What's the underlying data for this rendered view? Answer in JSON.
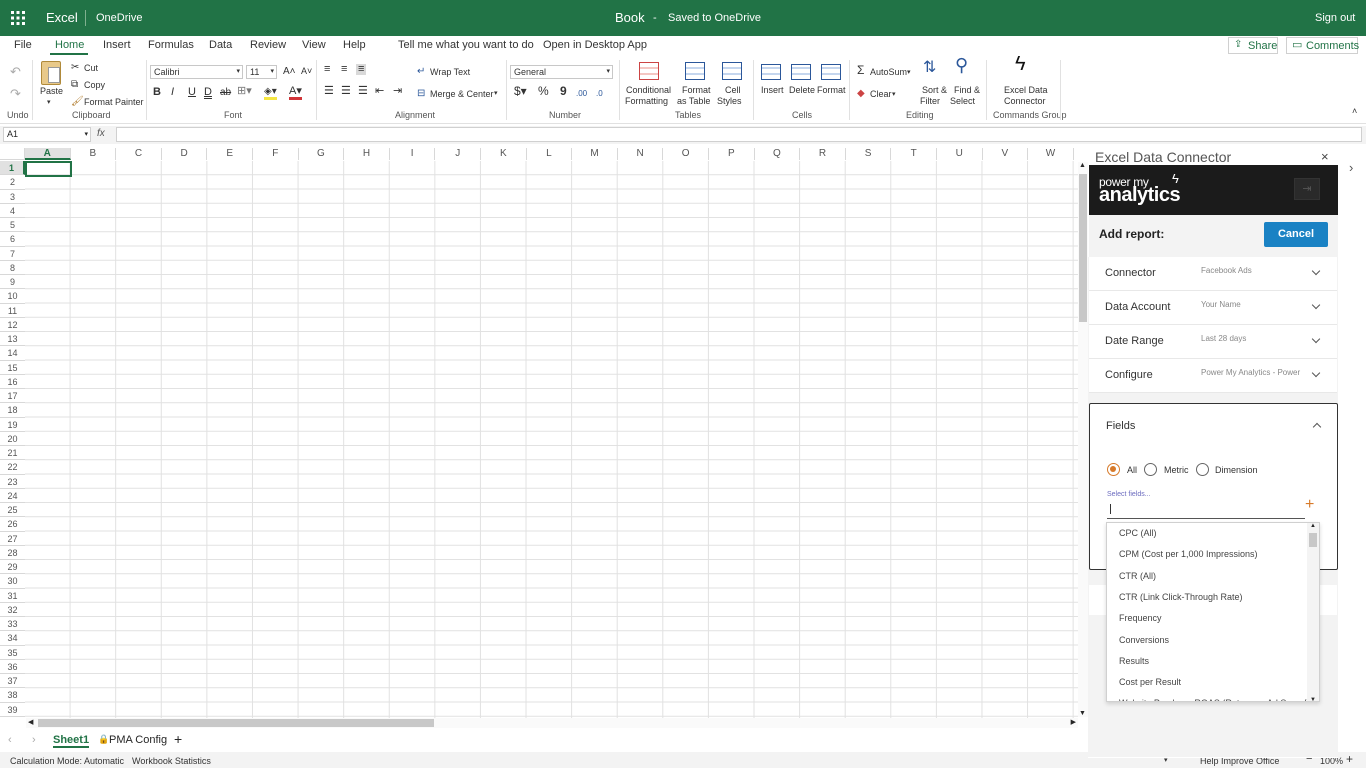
{
  "topbar": {
    "app_name": "Excel",
    "onedrive": "OneDrive",
    "book": "Book",
    "save_status": "Saved to OneDrive",
    "sign_out": "Sign out"
  },
  "menu": {
    "file": "File",
    "home": "Home",
    "insert": "Insert",
    "formulas": "Formulas",
    "data": "Data",
    "review": "Review",
    "view": "View",
    "help": "Help",
    "tell_me": "Tell me what you want to do",
    "open_desktop": "Open in Desktop App",
    "share": "Share",
    "comments": "Comments"
  },
  "ribbon": {
    "undo_group": "Undo",
    "paste": "Paste",
    "cut": "Cut",
    "copy": "Copy",
    "format_painter": "Format Painter",
    "clipboard_group": "Clipboard",
    "font_name": "Calibri",
    "font_size": "11",
    "font_group": "Font",
    "wrap_text": "Wrap Text",
    "merge_center": "Merge & Center",
    "alignment_group": "Alignment",
    "number_format": "General",
    "number_group": "Number",
    "conditional_1": "Conditional",
    "conditional_2": "Formatting",
    "format_table_1": "Format",
    "format_table_2": "as Table",
    "cell_styles_1": "Cell",
    "cell_styles_2": "Styles",
    "tables_group": "Tables",
    "insert": "Insert",
    "delete": "Delete",
    "format": "Format",
    "cells_group": "Cells",
    "autosum": "AutoSum",
    "clear": "Clear",
    "sort_1": "Sort &",
    "sort_2": "Filter",
    "find_1": "Find &",
    "find_2": "Select",
    "editing_group": "Editing",
    "edc_1": "Excel Data",
    "edc_2": "Connector",
    "commands_group": "Commands Group"
  },
  "formula_bar": {
    "name_box": "A1",
    "fx": "fx",
    "value": ""
  },
  "grid": {
    "columns": [
      "A",
      "B",
      "C",
      "D",
      "E",
      "F",
      "G",
      "H",
      "I",
      "J",
      "K",
      "L",
      "M",
      "N",
      "O",
      "P",
      "Q",
      "R",
      "S",
      "T",
      "U",
      "V",
      "W"
    ],
    "rows": [
      "1",
      "2",
      "3",
      "4",
      "5",
      "6",
      "7",
      "8",
      "9",
      "10",
      "11",
      "12",
      "13",
      "14",
      "15",
      "16",
      "17",
      "18",
      "19",
      "20",
      "21",
      "22",
      "23",
      "24",
      "25",
      "26",
      "27",
      "28",
      "29",
      "30",
      "31",
      "32",
      "33",
      "34",
      "35",
      "36",
      "37",
      "38",
      "39"
    ]
  },
  "sheet_tabs": {
    "sheet1": "Sheet1",
    "pma_config": "PMA Config",
    "add": "+"
  },
  "status": {
    "calc_mode": "Calculation Mode: Automatic",
    "workbook_stats": "Workbook Statistics",
    "help_improve": "Help Improve Office",
    "zoom": "100%"
  },
  "panel": {
    "title": "Excel Data Connector",
    "brand_1": "power my",
    "brand_2": "analytics",
    "add_report": "Add report:",
    "cancel": "Cancel",
    "rows": [
      {
        "label": "Connector",
        "value": "Facebook Ads"
      },
      {
        "label": "Data Account",
        "value": "Your Name"
      },
      {
        "label": "Date Range",
        "value": "Last 28 days"
      },
      {
        "label": "Configure",
        "value": "Power My Analytics - Power"
      }
    ],
    "fields_label": "Fields",
    "radio_all": "All",
    "radio_metric": "Metric",
    "radio_dimension": "Dimension",
    "select_placeholder": "Select fields...",
    "dropdown_items": [
      "CPC (All)",
      "CPM (Cost per 1,000 Impressions)",
      "CTR (All)",
      "CTR (Link Click-Through Rate)",
      "Frequency",
      "Conversions",
      "Results",
      "Cost per Result",
      "Website Purchase ROAS (Return on Ad Spend)"
    ],
    "accent_color": "#1a82c4",
    "radio_selected_color": "#d77a2a"
  }
}
